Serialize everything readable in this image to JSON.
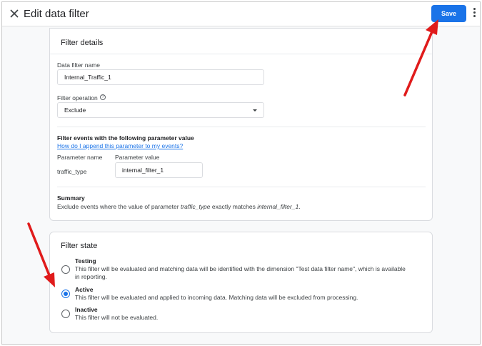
{
  "header": {
    "title": "Edit data filter",
    "save_label": "Save"
  },
  "filter_details": {
    "title": "Filter details",
    "name_label": "Data filter name",
    "name_value": "Internal_Traffic_1",
    "operation_label": "Filter operation",
    "operation_value": "Exclude",
    "events_heading": "Filter events with the following parameter value",
    "append_link": "How do I append this parameter to my events?",
    "param_name_header": "Parameter name",
    "param_value_header": "Parameter value",
    "param_name": "traffic_type",
    "param_value": "internal_filter_1",
    "summary_heading": "Summary",
    "summary_prefix": "Exclude events where the value of parameter ",
    "summary_param": "traffic_type",
    "summary_middle": " exactly matches ",
    "summary_value": "internal_filter_1",
    "summary_suffix": "."
  },
  "filter_state": {
    "title": "Filter state",
    "options": [
      {
        "label": "Testing",
        "description": "This filter will be evaluated and matching data will be identified with the dimension \"Test data filter name\", which is available in reporting.",
        "selected": false
      },
      {
        "label": "Active",
        "description": "This filter will be evaluated and applied to incoming data. Matching data will be excluded from processing.",
        "selected": true
      },
      {
        "label": "Inactive",
        "description": "This filter will not be evaluated.",
        "selected": false
      }
    ]
  },
  "colors": {
    "accent": "#1a73e8",
    "annotation_arrow": "#e01b1b"
  }
}
